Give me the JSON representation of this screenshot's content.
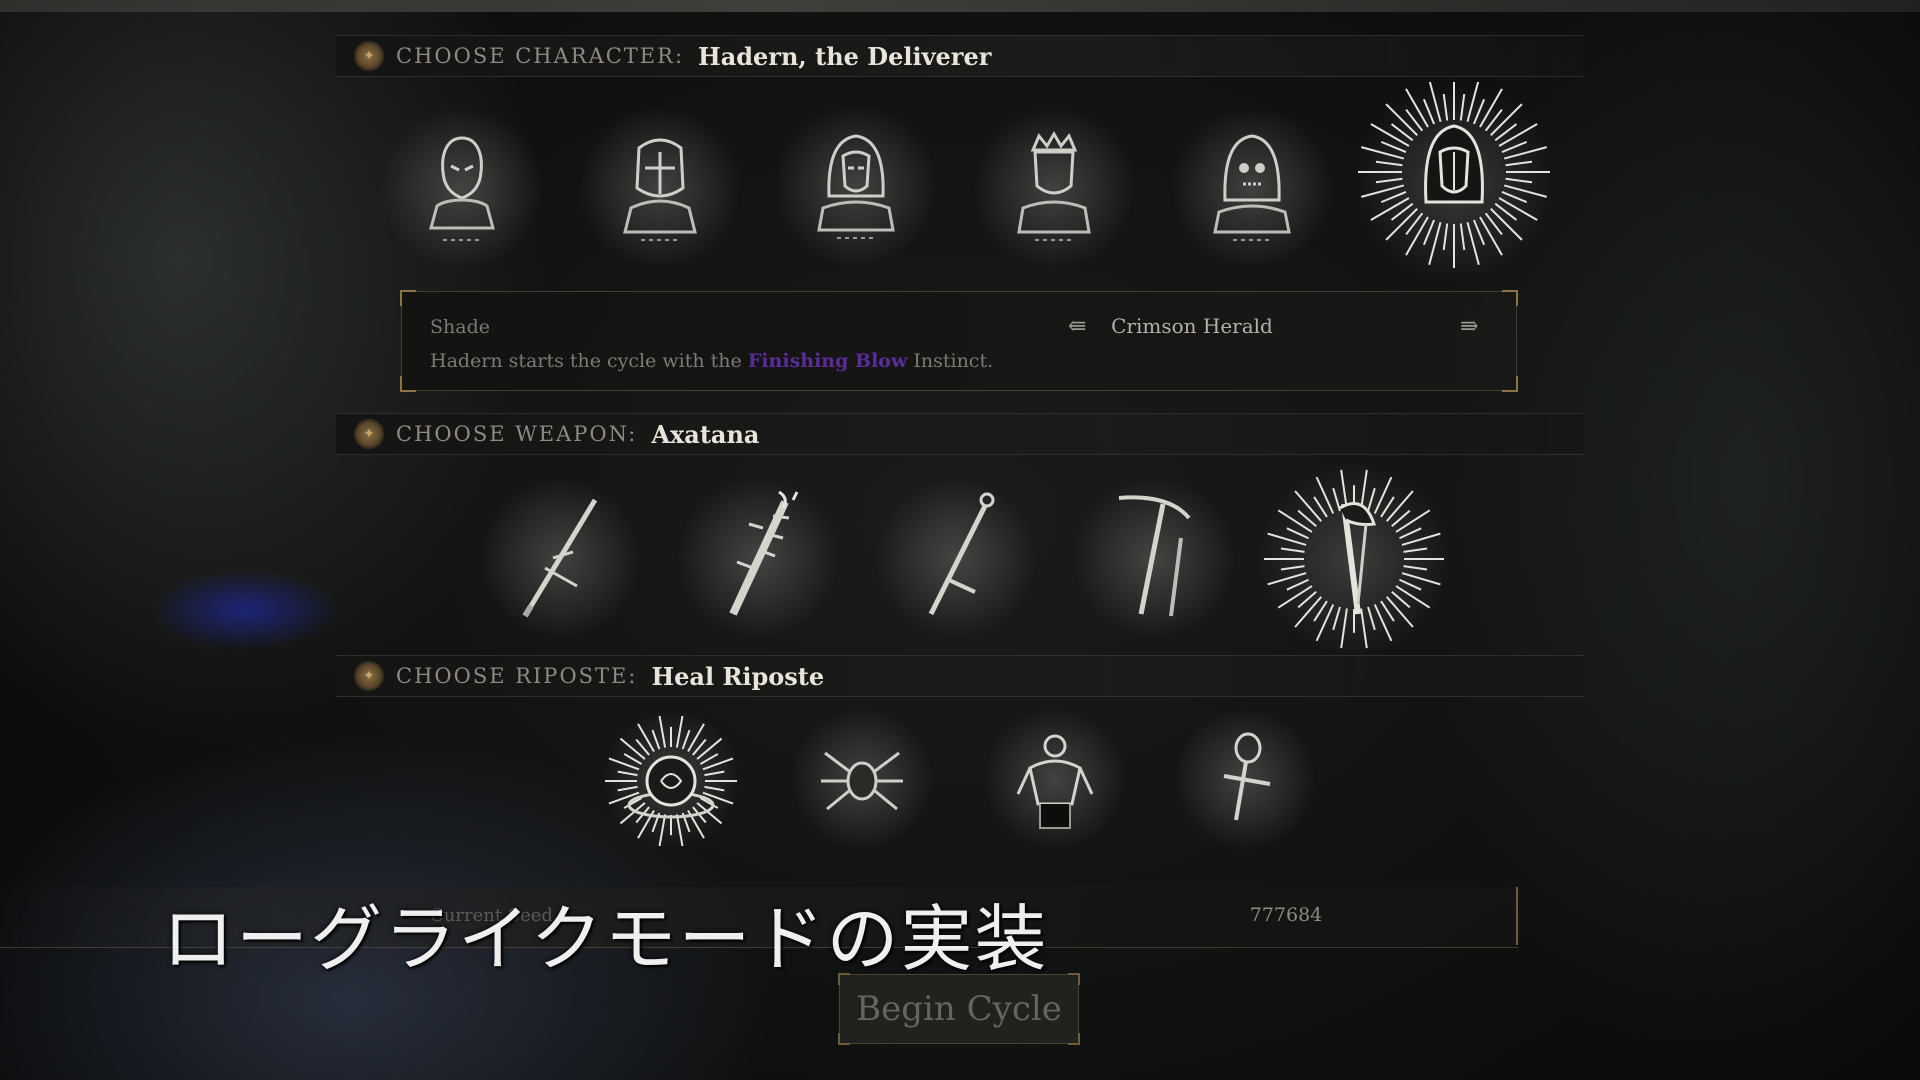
{
  "sections": {
    "character": {
      "label": "CHOOSE CHARACTER:",
      "value": "Hadern, the Deliverer"
    },
    "weapon": {
      "label": "CHOOSE WEAPON:",
      "value": "Axatana"
    },
    "riposte": {
      "label": "CHOOSE RIPOSTE:",
      "value": "Heal Riposte"
    }
  },
  "character_info": {
    "class_name": "Shade",
    "description_prefix": "Hadern starts the cycle with the ",
    "description_highlight": "Finishing Blow",
    "description_suffix": " Instinct.",
    "variant_name": "Crimson Herald",
    "prev_arrow": "⇚",
    "next_arrow": "⇛"
  },
  "seed": {
    "label": "Current Seed",
    "value": "777684"
  },
  "begin_button": {
    "label": "Begin Cycle"
  },
  "subtitle": "ローグライクモードの実装",
  "colors": {
    "highlight": "#5a2c9a",
    "gold_trim": "#8a7346",
    "text_main": "#e8e4da",
    "text_muted": "#8e8a80"
  },
  "icons": {
    "characters": [
      "character-portrait-1",
      "character-portrait-2",
      "character-portrait-3",
      "character-portrait-4",
      "character-portrait-5",
      "character-portrait-hadern-selected"
    ],
    "weapons": [
      "weapon-sword-icon",
      "weapon-spiked-mace-icon",
      "weapon-greatsword-icon",
      "weapon-scythe-icon",
      "weapon-axatana-selected-icon"
    ],
    "ripostes": [
      "heal-riposte-selected-icon",
      "spider-riposte-icon",
      "figure-riposte-icon",
      "ankh-riposte-icon"
    ]
  }
}
